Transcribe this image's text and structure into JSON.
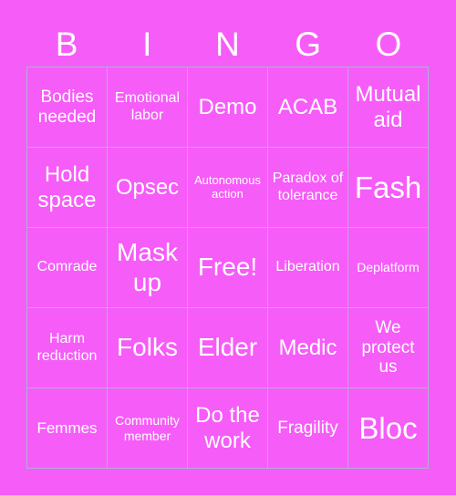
{
  "header": {
    "letters": [
      "B",
      "I",
      "N",
      "G",
      "O"
    ]
  },
  "colors": {
    "background": "#f65cf8",
    "grid_line": "#a4b6d2",
    "text": "#ffffff"
  },
  "board": {
    "rows": [
      [
        "Bodies needed",
        "Emotional labor",
        "Demo",
        "ACAB",
        "Mutual aid"
      ],
      [
        "Hold space",
        "Opsec",
        "Autonomous action",
        "Paradox of tolerance",
        "Fash"
      ],
      [
        "Comrade",
        "Mask up",
        "Free!",
        "Liberation",
        "Deplatform"
      ],
      [
        "Harm reduction",
        "Folks",
        "Elder",
        "Medic",
        "We protect us"
      ],
      [
        "Femmes",
        "Community member",
        "Do the work",
        "Fragility",
        "Bloc"
      ]
    ]
  }
}
